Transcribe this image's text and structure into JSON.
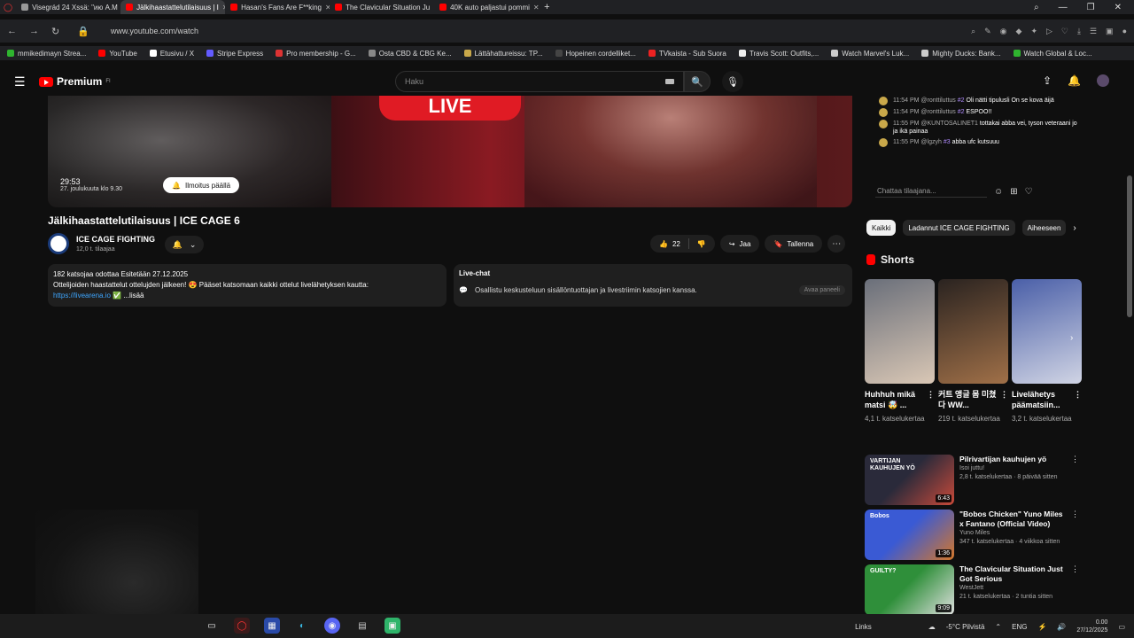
{
  "browser": {
    "tabs": [
      {
        "label": "Visegrád 24 Xssä: \"ию А.М",
        "color": "#999",
        "active": false
      },
      {
        "label": "Jälkihaastattelutilaisuus | I",
        "color": "#ff0000",
        "active": true
      },
      {
        "label": "Hasan's Fans Are F**king",
        "color": "#ff0000",
        "active": false
      },
      {
        "label": "The Clavicular Situation Ju",
        "color": "#ff0000",
        "active": false
      },
      {
        "label": "40K auto paljastui pommi",
        "color": "#ff0000",
        "active": false
      }
    ],
    "new_tab": "+",
    "url": "www.youtube.com/watch",
    "bookmarks": [
      {
        "label": "mmikedimayn Strea...",
        "color": "#2fb42f"
      },
      {
        "label": "YouTube",
        "color": "#ff0000"
      },
      {
        "label": "Etusivu / X",
        "color": "#ffffff"
      },
      {
        "label": "Stripe Express",
        "color": "#635bff"
      },
      {
        "label": "Pro membership - G...",
        "color": "#d33"
      },
      {
        "label": "Osta CBD & CBG Ke...",
        "color": "#888"
      },
      {
        "label": "Lättähattureissu: TP...",
        "color": "#c9a84a"
      },
      {
        "label": "Hopeinen cordelliket...",
        "color": "#444"
      },
      {
        "label": "TVkaista - Sub Suora",
        "color": "#e22"
      },
      {
        "label": "Travis Scott: Outfits,...",
        "color": "#eee"
      },
      {
        "label": "Watch Marvel's Luk...",
        "color": "#ccc"
      },
      {
        "label": "Mighty Ducks: Bank...",
        "color": "#ccc"
      },
      {
        "label": "Watch Global & Loc...",
        "color": "#2fb42f"
      }
    ]
  },
  "youtube": {
    "logo_text": "Premium",
    "logo_sup": "FI",
    "search_placeholder": "Haku"
  },
  "player": {
    "live_text": "LIVE",
    "countdown": "29:53",
    "countdown_sub": "27. joulukuuta klo 9.30",
    "notify_label": "Ilmoitus päällä"
  },
  "video": {
    "title": "Jälkihaastattelutilaisuus | ICE CAGE 6",
    "channel_name": "ICE CAGE FIGHTING",
    "channel_subs": "12,0 t. tilaajaa",
    "likes": "22",
    "share_label": "Jaa",
    "save_label": "Tallenna"
  },
  "description": {
    "line1": "182 katsojaa odottaa  Esitetään 27.12.2025",
    "line2": "Ottelijoiden haastattelut ottelujden jälkeen! 😍  Pääset katsomaan kaikki ottelut livelähetyksen kautta:",
    "link": "https://livearena.io",
    "more": "...lisää"
  },
  "livechat_box": {
    "title": "Live-chat",
    "text": "Osallistu keskusteluun sisällöntuottajan ja livestriimin katsojien kanssa.",
    "open_label": "Avaa paneeli"
  },
  "chat": {
    "messages": [
      {
        "time": "11:54 PM",
        "user": "@ronttiluttus",
        "badge": "#2",
        "text": "Oli nätti tipulusli On se kova äijä"
      },
      {
        "time": "11:54 PM",
        "user": "@ronttiluttus",
        "badge": "#2",
        "text": "ESPOO!!"
      },
      {
        "time": "11:55 PM",
        "user": "@KUNTOSALINET1",
        "badge": "",
        "text": "tottakai abba vei, tyson veteraani jo ja ikä painaa"
      },
      {
        "time": "11:55 PM",
        "user": "@lgzyh",
        "badge": "#3",
        "text": "abba ufc kutsuuu"
      }
    ],
    "input_placeholder": "Chattaa tilaajana..."
  },
  "chips": [
    "Kaikki",
    "Ladannut ICE CAGE FIGHTING",
    "Aiheeseen"
  ],
  "shorts": {
    "heading": "Shorts",
    "items": [
      {
        "title": "Huhhuh mikä matsi 🤯 ...",
        "views": "4,1 t. katselukertaa",
        "c1": "#6a6f7a",
        "c2": "#d9c7b5"
      },
      {
        "title": "커트 앵글 몸 미쳤다 WW...",
        "views": "219 t. katselukertaa",
        "c1": "#2a2320",
        "c2": "#a07048"
      },
      {
        "title": "Livelähetys päämatsiin...",
        "views": "3,2 t. katselukertaa",
        "c1": "#4a5fa8",
        "c2": "#d0d4e4"
      }
    ]
  },
  "recommended": [
    {
      "title": "Pilrivartijan kauhujen yö",
      "channel": "Isoi juttu!",
      "meta": "2,8 t. katselukertaa · 8 päivää sitten",
      "duration": "6:43",
      "c1": "#2a2a3a",
      "c2": "#c94a3a",
      "label": "VARTIJAN KAUHUJEN YÖ"
    },
    {
      "title": "\"Bobos Chicken\" Yuno Miles x Fantano (Official Video)",
      "channel": "Yuno Miles",
      "meta": "347 t. katselukertaa · 4 viikkoa sitten",
      "duration": "1:36",
      "c1": "#3a5ad4",
      "c2": "#d4772a",
      "label": "Bobos"
    },
    {
      "title": "The Clavicular Situation Just Got Serious",
      "channel": "WestJett",
      "meta": "21 t. katselukertaa · 2 tuntia sitten",
      "duration": "9:09",
      "c1": "#2f8f3a",
      "c2": "#e0e0e0",
      "label": "GUILTY?"
    }
  ],
  "taskbar": {
    "links": "Links",
    "weather": "-5°C  Pilvistä",
    "lang": "ENG",
    "time": "0.00",
    "date": "27/12/2025"
  }
}
